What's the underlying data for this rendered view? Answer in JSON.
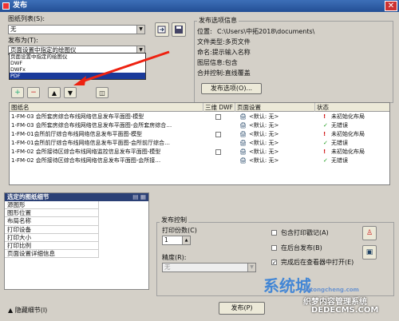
{
  "window": {
    "title": "发布",
    "close": "✕"
  },
  "left": {
    "sheet_list_label": "图纸列表(S):",
    "sheet_list_value": "无",
    "publish_to_label": "发布为(T):",
    "publish_to_value": "页面设置中指定的绘图仪",
    "options": [
      "页面设置中指定的绘图仪",
      "DWF",
      "DWFx",
      "PDF"
    ],
    "selected_option": "PDF"
  },
  "info": {
    "title": "发布选项信息",
    "location_label": "位置:",
    "location_value": "C:\\Users\\中拓2018\\documents\\",
    "file_type": "文件类型:多页文件",
    "naming": "命名:提示输入名称",
    "layer_info": "图层信息:包含",
    "merge": "合并控制:直线覆盖",
    "options_button": "发布选项(O)..."
  },
  "table": {
    "columns": [
      "图纸名",
      "三维 DWF",
      "页面设置",
      "状态"
    ],
    "rows": [
      {
        "name": "1-FM-03 会所套房综合布线网络信息发布平面图-模型",
        "has3d": true,
        "setup": "<默认: 无>",
        "status": "未初始化布局",
        "ok": false
      },
      {
        "name": "1-FM-03 会所套房综合布线网络信息发布平面图-会所套房综合…",
        "has3d": false,
        "setup": "<默认: 无>",
        "status": "无错误",
        "ok": true
      },
      {
        "name": "1-FM-01会所前厅综合布线网络信息发布平面图-模型",
        "has3d": true,
        "setup": "<默认: 无>",
        "status": "未初始化布局",
        "ok": false
      },
      {
        "name": "1-FM-01会所前厅综合布线网络信息发布平面图-会所前厅综合…",
        "has3d": false,
        "setup": "<默认: 无>",
        "status": "无错误",
        "ok": true
      },
      {
        "name": "1-FM-02 会所接待区综合布线网络监控信息发布平面图-模型",
        "has3d": true,
        "setup": "<默认: 无>",
        "status": "未初始化布局",
        "ok": false
      },
      {
        "name": "1-FM-02 会所接待区综合布线网络信息发布平面图-会所接…",
        "has3d": false,
        "setup": "<默认: 无>",
        "status": "无错误",
        "ok": true
      }
    ]
  },
  "details": {
    "title": "选定的图纸细节",
    "rows": [
      "源图形",
      "图形位置",
      "布局名称",
      "打印设备",
      "打印大小",
      "打印比例",
      "页面设置详细信息"
    ]
  },
  "control": {
    "title": "发布控制",
    "copies_label": "打印份数(C)",
    "copies_value": "1",
    "precision_label": "精度(R):",
    "precision_value": "无",
    "include_stamp": "包含打印戳记(A)",
    "background": "在后台发布(B)",
    "open_viewer": "完成后在查看器中打开(E)",
    "include_stamp_checked": false,
    "background_checked": false,
    "open_viewer_checked": true
  },
  "footer": {
    "hide_details": "隐藏细节(I)",
    "publish": "发布(P)"
  },
  "watermark": {
    "text1": "系统城",
    "text2": "xitongcheng.com",
    "text3": "织梦内容管理系统",
    "text4": "DEDECMS.COM"
  }
}
